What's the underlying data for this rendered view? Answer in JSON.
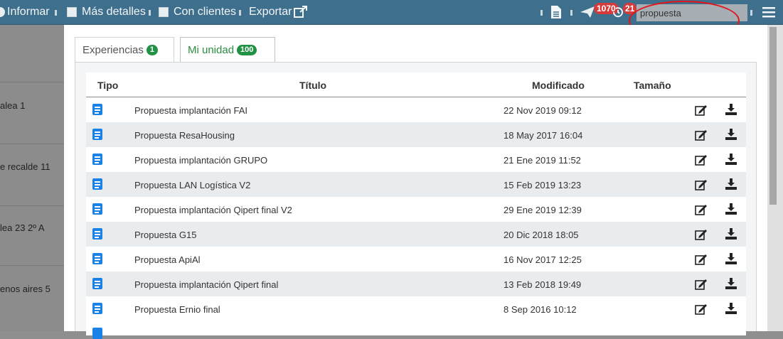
{
  "topbar": {
    "informar_label": "Informar",
    "mas_detalles_label": "Más detalles",
    "con_clientes_label": "Con clientes",
    "exportar_label": "Exportar",
    "notifications_count": "1070",
    "history_count": "21",
    "search_value": "propuesta",
    "icons": {
      "export": "external-link-icon",
      "document": "document-icon",
      "notifications": "paper-plane-icon",
      "history": "history-icon",
      "menu": "hamburger-menu-icon"
    }
  },
  "left_list": [
    {
      "text": "alea 1"
    },
    {
      "text": "e recalde 11"
    },
    {
      "text": "lea 23 2º A"
    },
    {
      "text": "enos aires 5"
    }
  ],
  "tabs": [
    {
      "label": "Experiencias",
      "count": "1"
    },
    {
      "label": "Mi unidad",
      "count": "100"
    }
  ],
  "table": {
    "headers": {
      "tipo": "Tipo",
      "titulo": "Título",
      "modificado": "Modificado",
      "tamano": "Tamaño"
    },
    "rows": [
      {
        "title": "Propuesta implantación FAI",
        "modified": "22 Nov 2019 09:12"
      },
      {
        "title": "Propuesta ResaHousing",
        "modified": "18 May 2017 16:04"
      },
      {
        "title": "Propuesta implantación GRUPO",
        "modified": "21 Ene 2019 11:52"
      },
      {
        "title": "Propuesta LAN Logística V2",
        "modified": "15 Feb 2019 13:23"
      },
      {
        "title": "Propuesta implantación Qipert final V2",
        "modified": "29 Ene 2019 12:39"
      },
      {
        "title": "Propuesta G15",
        "modified": "20 Dic 2018 18:05"
      },
      {
        "title": "Propuesta ApiAl",
        "modified": "16 Nov 2017 12:25"
      },
      {
        "title": "Propuesta implantación Qipert final",
        "modified": "13 Feb 2018 19:49"
      },
      {
        "title": "Propuesta Ernio final",
        "modified": "8 Sep 2016 10:12"
      }
    ]
  },
  "colors": {
    "topbar": "#3e6f8c",
    "accent_green": "#219244",
    "badge_red": "#d63a3a",
    "doc_icon_blue": "#1a82e6",
    "annotation_red": "#e3141a"
  }
}
